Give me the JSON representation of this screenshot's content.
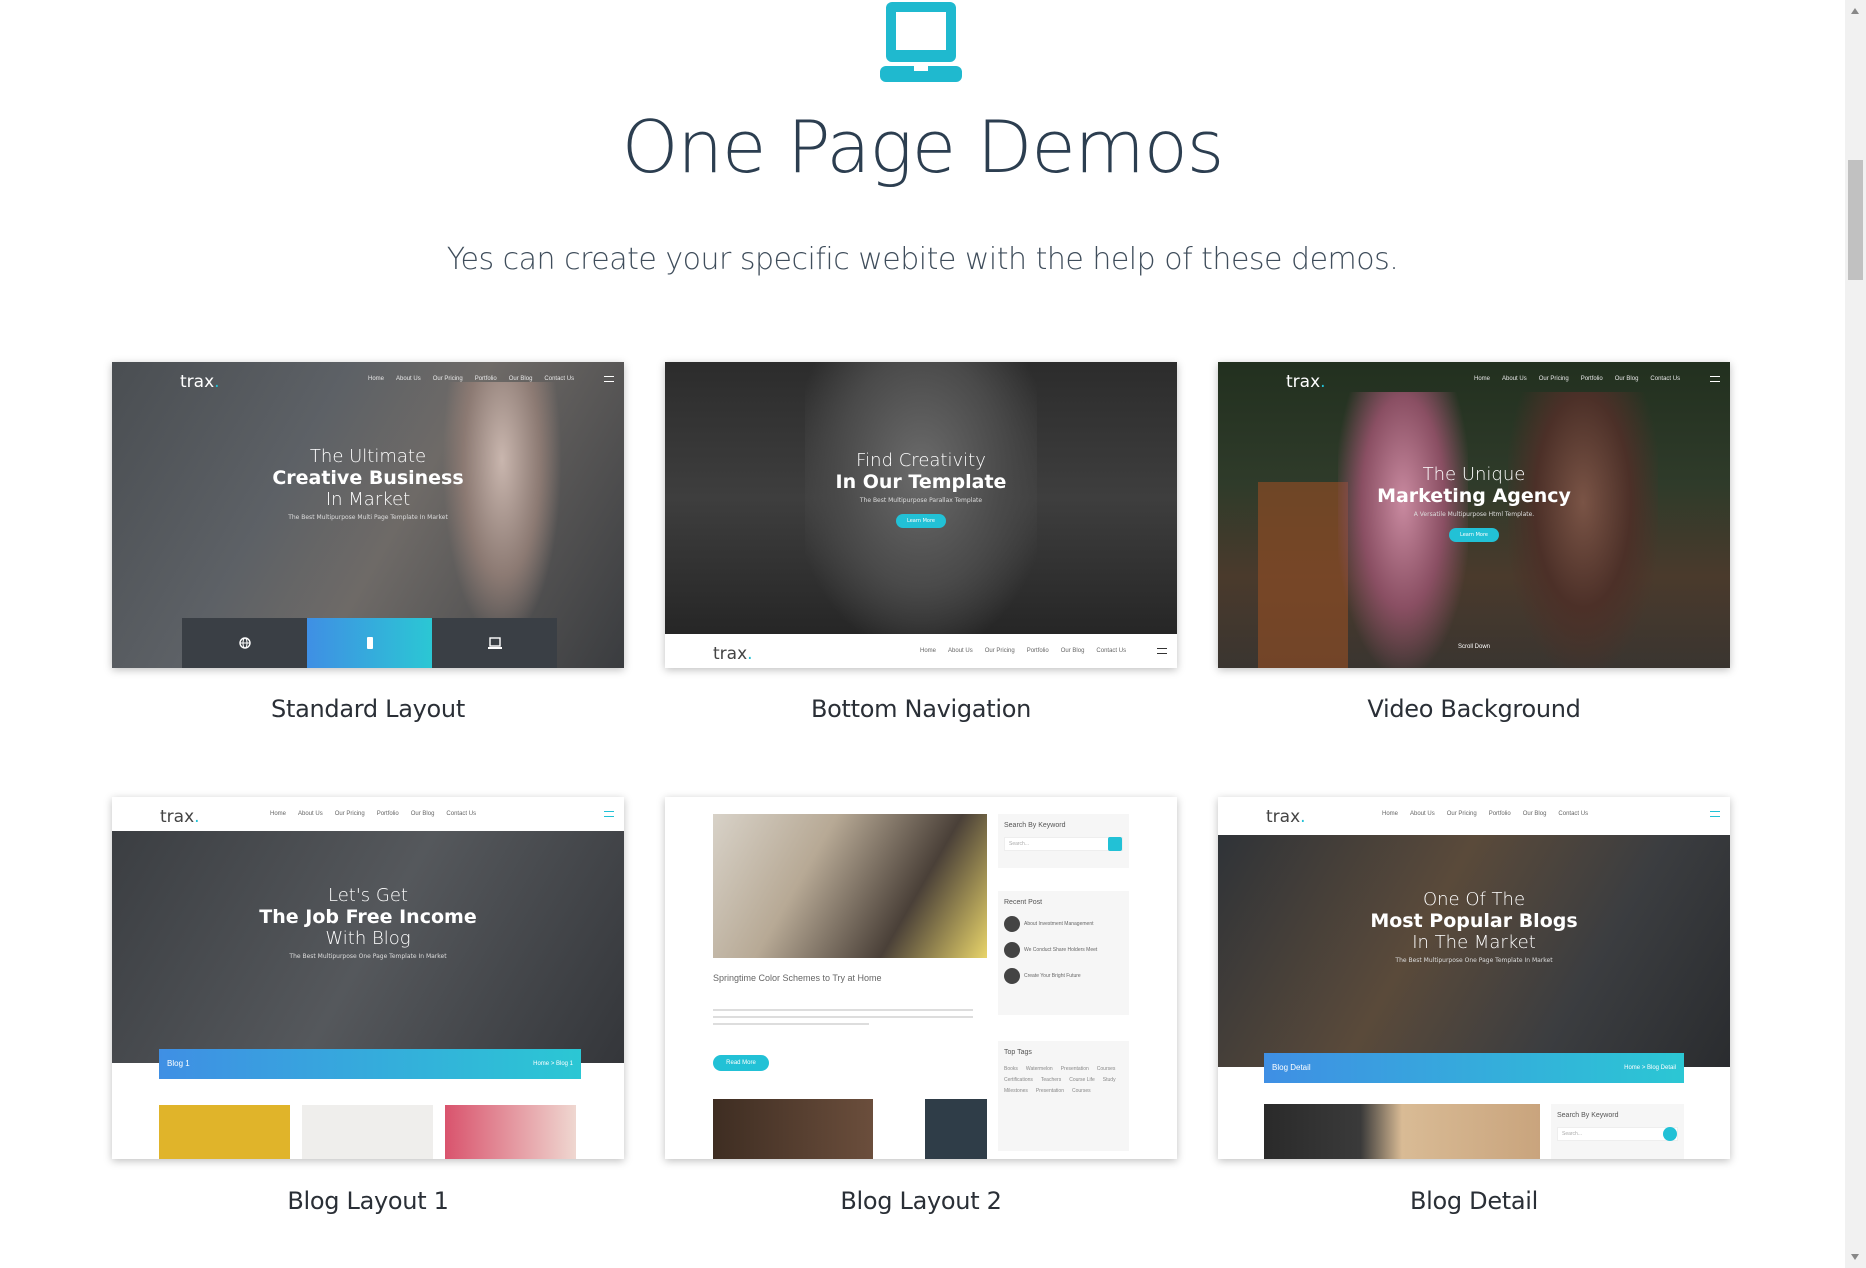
{
  "header": {
    "icon": "laptop-icon",
    "title": "One Page Demos",
    "subtitle": "Yes can create your specific webite with the help of these demos."
  },
  "colors": {
    "accent": "#22c1d6",
    "gradient_start": "#3f8fe4",
    "gradient_end": "#2bc7d4"
  },
  "nav": {
    "logo": "trax",
    "links": [
      "Home",
      "About Us",
      "Our Pricing",
      "Portfolio",
      "Our Blog",
      "Contact Us"
    ]
  },
  "demos": [
    {
      "label": "Standard Layout",
      "hero": {
        "l1": "The Ultimate",
        "l2": "Creative Business",
        "l3": "In Market",
        "small": "The Best Multipurpose Multi Page Template In Market"
      }
    },
    {
      "label": "Bottom Navigation",
      "hero": {
        "l1": "Find Creativity",
        "l2": "In Our Template",
        "small": "The Best Multipurpose Parallax Template",
        "button": "Learn More"
      }
    },
    {
      "label": "Video Background",
      "hero": {
        "l1": "The Unique",
        "l2": "Marketing Agency",
        "small": "A Versatile Multipurpose Html Template.",
        "button": "Learn More",
        "scroll": "Scroll Down"
      }
    },
    {
      "label": "Blog Layout 1",
      "hero": {
        "l1": "Let's Get",
        "l2": "The Job Free Income",
        "l3": "With Blog",
        "small": "The Best Multipurpose One Page Template In Market"
      },
      "banner": {
        "title": "Blog 1",
        "crumb": "Home > Blog 1"
      }
    },
    {
      "label": "Blog Layout 2",
      "post_title": "Springtime Color Schemes to Try at Home",
      "read_more": "Read More",
      "search_label": "Search By Keyword",
      "search_placeholder": "Search...",
      "recent_label": "Recent Post",
      "recent_posts": [
        "About Investment Management",
        "We Conduct Share Holders Meet",
        "Create Your Bright Future"
      ],
      "tags_label": "Top Tags",
      "tags": [
        "Books",
        "Watermelon",
        "Presentation",
        "Courses",
        "Certifications",
        "Teachers",
        "Course Life",
        "Study",
        "Milestones",
        "Presentation",
        "Courses"
      ]
    },
    {
      "label": "Blog Detail",
      "hero": {
        "l1": "One Of The",
        "l2": "Most Popular Blogs",
        "l3": "In The Market",
        "small": "The Best Multipurpose One Page Template In Market"
      },
      "banner": {
        "title": "Blog Detail",
        "crumb": "Home > Blog Detail"
      },
      "search_label": "Search By Keyword",
      "search_placeholder": "Search..."
    }
  ]
}
